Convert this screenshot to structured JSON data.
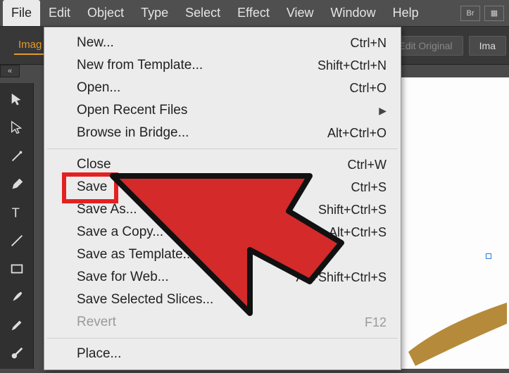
{
  "menubar": {
    "items": [
      "File",
      "Edit",
      "Object",
      "Type",
      "Select",
      "Effect",
      "View",
      "Window",
      "Help"
    ],
    "br_label": "Br"
  },
  "controlbar": {
    "tab_label": "Imag",
    "edit_original": "Edit Original",
    "ima_btn": "Ima"
  },
  "sidebar_mini": "«",
  "menu": {
    "groups": [
      [
        {
          "label": "New...",
          "shortcut": "Ctrl+N"
        },
        {
          "label": "New from Template...",
          "shortcut": "Shift+Ctrl+N"
        },
        {
          "label": "Open...",
          "shortcut": "Ctrl+O"
        },
        {
          "label": "Open Recent Files",
          "submenu": true
        },
        {
          "label": "Browse in Bridge...",
          "shortcut": "Alt+Ctrl+O"
        }
      ],
      [
        {
          "label": "Close",
          "shortcut": "Ctrl+W"
        },
        {
          "label": "Save",
          "shortcut": "Ctrl+S",
          "highlight": true
        },
        {
          "label": "Save As...",
          "shortcut": "Shift+Ctrl+S"
        },
        {
          "label": "Save a Copy...",
          "shortcut": "Alt+Ctrl+S"
        },
        {
          "label": "Save as Template..."
        },
        {
          "label": "Save for Web...",
          "shortcut": "Alt+Shift+Ctrl+S"
        },
        {
          "label": "Save Selected Slices..."
        },
        {
          "label": "Revert",
          "shortcut": "F12",
          "disabled": true
        }
      ],
      [
        {
          "label": "Place..."
        }
      ]
    ]
  },
  "tools": [
    "selection",
    "direct-select",
    "wand",
    "pen",
    "type",
    "line",
    "rect",
    "brush",
    "pencil",
    "blob",
    "eraser",
    "rotate"
  ]
}
